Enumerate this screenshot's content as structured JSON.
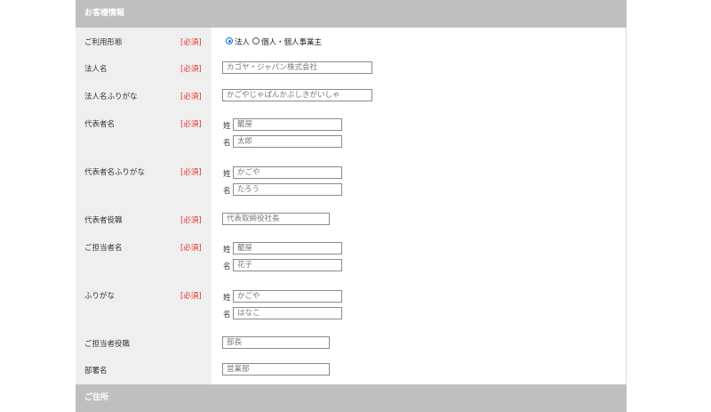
{
  "sections": {
    "customer_info": "お客様情報",
    "address": "ご住所"
  },
  "required_label": "[必須]",
  "fields": {
    "usage_type": {
      "label": "ご利用形態",
      "options": [
        "法人",
        "個人・個人事業主"
      ],
      "selected": "法人"
    },
    "company_name": {
      "label": "法人名",
      "value": "カゴヤ・ジャパン株式会社"
    },
    "company_kana": {
      "label": "法人名ふりがな",
      "value": "かごやじゃぱんかぶしきがいしゃ"
    },
    "rep_name": {
      "label": "代表者名",
      "sei_label": "姓",
      "mei_label": "名",
      "sei": "籠屋",
      "mei": "太郎"
    },
    "rep_kana": {
      "label": "代表者名ふりがな",
      "sei_label": "姓",
      "mei_label": "名",
      "sei": "かごや",
      "mei": "たろう"
    },
    "rep_title": {
      "label": "代表者役職",
      "value": "代表取締役社長"
    },
    "contact_name": {
      "label": "ご担当者名",
      "sei_label": "姓",
      "mei_label": "名",
      "sei": "籠屋",
      "mei": "花子"
    },
    "contact_kana": {
      "label": "ふりがな",
      "sei_label": "姓",
      "mei_label": "名",
      "sei": "かごや",
      "mei": "はなこ"
    },
    "contact_title": {
      "label": "ご担当者役職",
      "value": "部長"
    },
    "department": {
      "label": "部署名",
      "value": "営業部"
    }
  },
  "colors": {
    "header_bg": "#bfbfbf",
    "label_bg": "#efefef",
    "required": "#e0342c",
    "radio_selected": "#1a73e8"
  }
}
